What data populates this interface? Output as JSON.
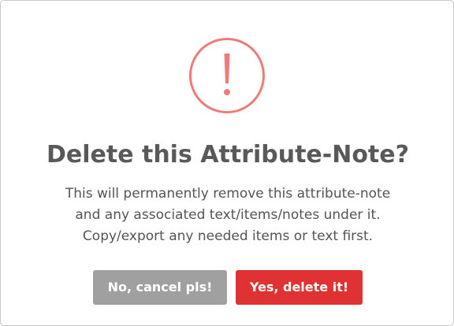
{
  "dialog": {
    "icon": "exclamation-circle-icon",
    "title": "Delete this Attribute-Note?",
    "message_lines": [
      "This will permanently remove this attribute-note",
      "and any associated text/items/notes under it.",
      "Copy/export any needed items or text first."
    ],
    "cancel_label": "No, cancel pls!",
    "confirm_label": "Yes, delete it!"
  },
  "colors": {
    "warning_icon": "#ee7b79",
    "title_text": "#595959",
    "body_text": "#545454",
    "cancel_button": "#a0a0a0",
    "confirm_button": "#e03232"
  }
}
